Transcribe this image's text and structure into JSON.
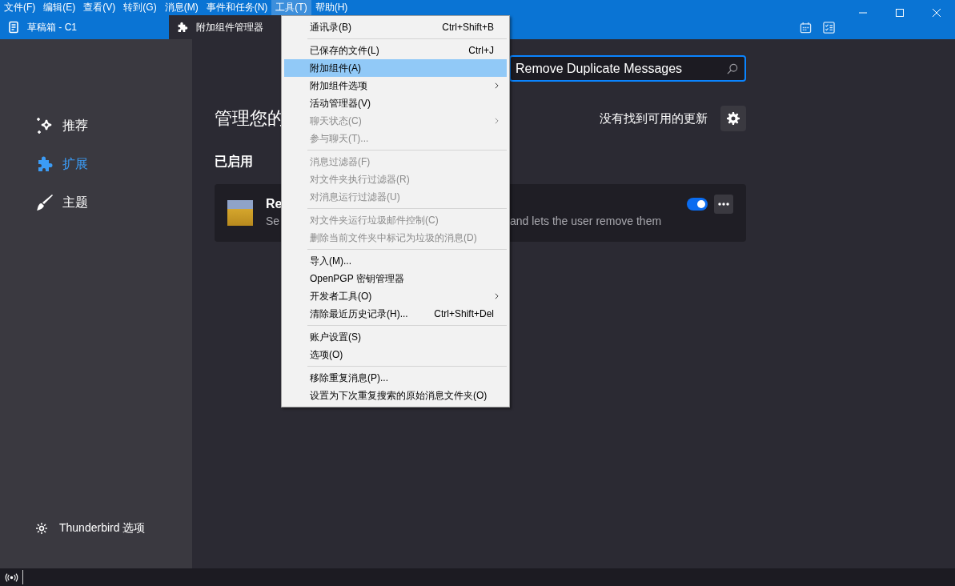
{
  "menubar": [
    {
      "label": "文件(F)",
      "selected": false
    },
    {
      "label": "编辑(E)",
      "selected": false
    },
    {
      "label": "查看(V)",
      "selected": false
    },
    {
      "label": "转到(G)",
      "selected": false
    },
    {
      "label": "消息(M)",
      "selected": false
    },
    {
      "label": "事件和任务(N)",
      "selected": false
    },
    {
      "label": "工具(T)",
      "selected": true
    },
    {
      "label": "帮助(H)",
      "selected": false
    }
  ],
  "tabs": [
    {
      "kind": "drafts",
      "label": "草稿箱 - C1",
      "selected": false
    },
    {
      "kind": "addons",
      "label": "附加组件管理器",
      "selected": true
    }
  ],
  "menu": {
    "groups": [
      [
        {
          "label": "通讯录(B)",
          "shortcut": "Ctrl+Shift+B",
          "submenu": false,
          "disabled": false,
          "selected": false
        }
      ],
      [
        {
          "label": "已保存的文件(L)",
          "shortcut": "Ctrl+J",
          "submenu": false,
          "disabled": false,
          "selected": false
        },
        {
          "label": "附加组件(A)",
          "submenu": false,
          "disabled": false,
          "selected": true
        },
        {
          "label": "附加组件选项",
          "submenu": true,
          "disabled": false,
          "selected": false
        },
        {
          "label": "活动管理器(V)",
          "submenu": false,
          "disabled": false,
          "selected": false
        },
        {
          "label": "聊天状态(C)",
          "submenu": true,
          "disabled": true,
          "selected": false
        },
        {
          "label": "参与聊天(T)...",
          "submenu": false,
          "disabled": true,
          "selected": false
        }
      ],
      [
        {
          "label": "消息过滤器(F)",
          "submenu": false,
          "disabled": true,
          "selected": false
        },
        {
          "label": "对文件夹执行过滤器(R)",
          "submenu": false,
          "disabled": true,
          "selected": false
        },
        {
          "label": "对消息运行过滤器(U)",
          "submenu": false,
          "disabled": true,
          "selected": false
        }
      ],
      [
        {
          "label": "对文件夹运行垃圾邮件控制(C)",
          "submenu": false,
          "disabled": true,
          "selected": false
        },
        {
          "label": "删除当前文件夹中标记为垃圾的消息(D)",
          "submenu": false,
          "disabled": true,
          "selected": false
        }
      ],
      [
        {
          "label": "导入(M)...",
          "submenu": false,
          "disabled": false,
          "selected": false
        },
        {
          "label": "OpenPGP 密钥管理器",
          "submenu": false,
          "disabled": false,
          "selected": false
        },
        {
          "label": "开发者工具(O)",
          "submenu": true,
          "disabled": false,
          "selected": false
        },
        {
          "label": "清除最近历史记录(H)...",
          "shortcut": "Ctrl+Shift+Del",
          "submenu": false,
          "disabled": false,
          "selected": false
        }
      ],
      [
        {
          "label": "账户设置(S)",
          "submenu": false,
          "disabled": false,
          "selected": false
        },
        {
          "label": "选项(O)",
          "submenu": false,
          "disabled": false,
          "selected": false
        }
      ],
      [
        {
          "label": "移除重复消息(P)...",
          "submenu": false,
          "disabled": false,
          "selected": false
        },
        {
          "label": "设置为下次重复搜索的原始消息文件夹(O)",
          "submenu": false,
          "disabled": false,
          "selected": false
        }
      ]
    ]
  },
  "sidebar": {
    "items": [
      {
        "kind": "recommended",
        "label": "推荐",
        "selected": false
      },
      {
        "kind": "extensions",
        "label": "扩展",
        "selected": true
      },
      {
        "kind": "themes",
        "label": "主题",
        "selected": false
      }
    ],
    "footer": "Thunderbird 选项"
  },
  "main": {
    "search": {
      "value": "Remove Duplicate Messages"
    },
    "heading": "管理您的",
    "update_status": "没有找到可用的更新",
    "section": "已启用",
    "card": {
      "name": "Re",
      "description_start": "Se",
      "description_end": "and lets the user remove them",
      "enabled": true
    }
  }
}
